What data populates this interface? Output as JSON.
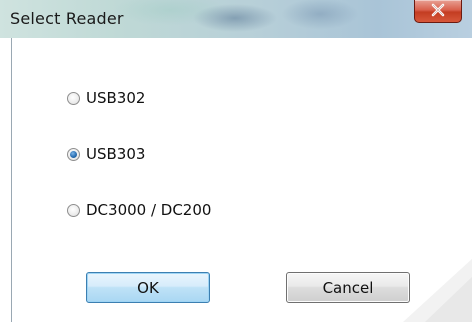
{
  "window": {
    "title": "Select Reader",
    "close_icon": "close-icon"
  },
  "options": [
    {
      "label": "USB302",
      "checked": false
    },
    {
      "label": "USB303",
      "checked": true
    },
    {
      "label": "DC3000 / DC200",
      "checked": false
    }
  ],
  "buttons": {
    "ok_label": "OK",
    "cancel_label": "Cancel"
  },
  "colors": {
    "close_button": "#c33d22",
    "default_button_border": "#3c7fb1",
    "radio_selected": "#2a6fb3"
  }
}
